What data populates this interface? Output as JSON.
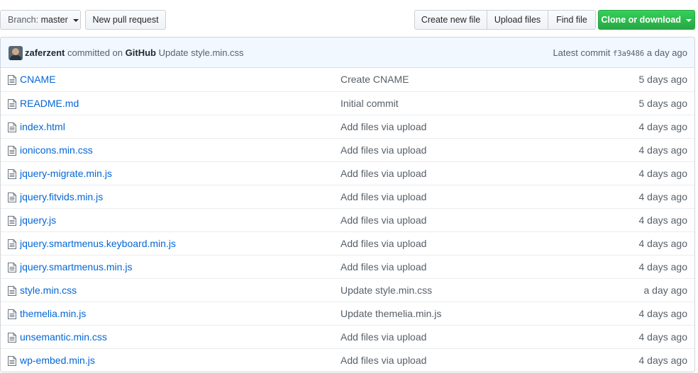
{
  "toolbar": {
    "branch_label": "Branch:",
    "branch_value": "master",
    "new_pull_request": "New pull request",
    "create_new_file": "Create new file",
    "upload_files": "Upload files",
    "find_file": "Find file",
    "clone_or_download": "Clone or download"
  },
  "commit": {
    "author": "zaferzent",
    "committed_on": "committed on",
    "platform": "GitHub",
    "message": "Update style.min.css",
    "latest_label": "Latest commit",
    "sha": "f3a9486",
    "age": "a day ago"
  },
  "files": [
    {
      "name": "CNAME",
      "message": "Create CNAME",
      "age": "5 days ago"
    },
    {
      "name": "README.md",
      "message": "Initial commit",
      "age": "5 days ago"
    },
    {
      "name": "index.html",
      "message": "Add files via upload",
      "age": "4 days ago"
    },
    {
      "name": "ionicons.min.css",
      "message": "Add files via upload",
      "age": "4 days ago"
    },
    {
      "name": "jquery-migrate.min.js",
      "message": "Add files via upload",
      "age": "4 days ago"
    },
    {
      "name": "jquery.fitvids.min.js",
      "message": "Add files via upload",
      "age": "4 days ago"
    },
    {
      "name": "jquery.js",
      "message": "Add files via upload",
      "age": "4 days ago"
    },
    {
      "name": "jquery.smartmenus.keyboard.min.js",
      "message": "Add files via upload",
      "age": "4 days ago"
    },
    {
      "name": "jquery.smartmenus.min.js",
      "message": "Add files via upload",
      "age": "4 days ago"
    },
    {
      "name": "style.min.css",
      "message": "Update style.min.css",
      "age": "a day ago"
    },
    {
      "name": "themelia.min.js",
      "message": "Update themelia.min.js",
      "age": "4 days ago"
    },
    {
      "name": "unsemantic.min.css",
      "message": "Add files via upload",
      "age": "4 days ago"
    },
    {
      "name": "wp-embed.min.js",
      "message": "Add files via upload",
      "age": "4 days ago"
    }
  ],
  "icons": {
    "file": "file-icon",
    "caret": "caret-down-icon",
    "avatar": "avatar"
  },
  "colors": {
    "link": "#0366d6",
    "clone_button": "#28a745",
    "commit_bar": "#f1f8ff"
  }
}
